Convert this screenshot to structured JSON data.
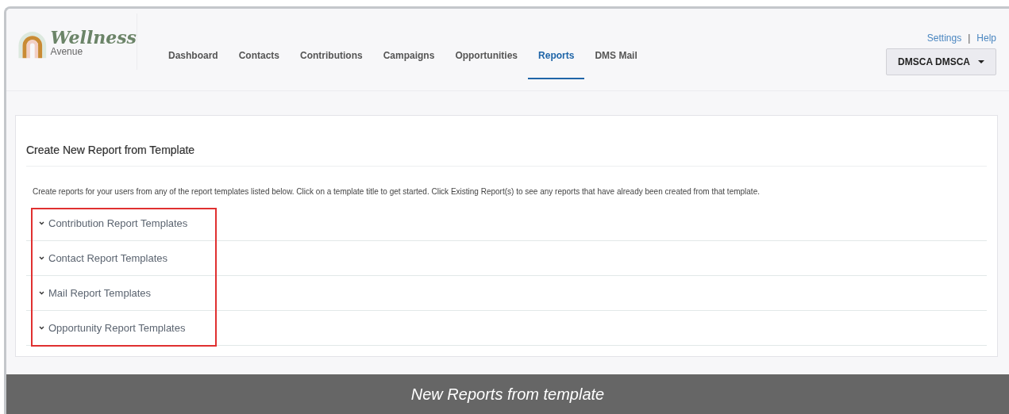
{
  "logo": {
    "title": "Wellness",
    "subtitle": "Avenue"
  },
  "nav": [
    {
      "label": "Dashboard",
      "selected": false
    },
    {
      "label": "Contacts",
      "selected": false
    },
    {
      "label": "Contributions",
      "selected": false
    },
    {
      "label": "Campaigns",
      "selected": false
    },
    {
      "label": "Opportunities",
      "selected": false
    },
    {
      "label": "Reports",
      "selected": true
    },
    {
      "label": "DMS Mail",
      "selected": false
    }
  ],
  "top_links": [
    "Settings",
    "|",
    "Help"
  ],
  "user_menu": {
    "label": "DMSCA DMSCA"
  },
  "card": {
    "title": "Create New Report from Template",
    "description": "Create reports for your users from any of the report templates listed below. Click on a template title to get started. Click Existing Report(s) to see any reports that have already been created from that template.",
    "sections": [
      {
        "label": "Contribution Report Templates",
        "expanded": false
      },
      {
        "label": "Contact Report Templates",
        "expanded": false
      },
      {
        "label": "Mail Report Templates",
        "expanded": false
      },
      {
        "label": "Opportunity Report Templates",
        "expanded": false
      }
    ]
  },
  "caption": "New Reports from template"
}
